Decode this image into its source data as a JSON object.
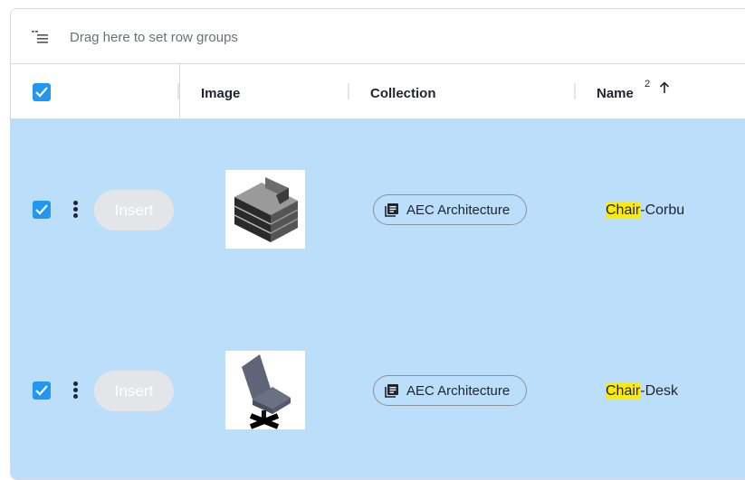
{
  "group_bar": {
    "placeholder": "Drag here to set row groups",
    "icon": "row-groups-icon"
  },
  "header": {
    "columns": [
      {
        "label": "Image"
      },
      {
        "label": "Collection"
      },
      {
        "label": "Name",
        "sort_index": "2",
        "sort_direction": "ascending"
      }
    ]
  },
  "rows": [
    {
      "selected": true,
      "action_label": "Insert",
      "image_icon": "sofa-thumbnail",
      "collection": "AEC Architecture",
      "name_highlight": "Chair",
      "name_rest": "-Corbu"
    },
    {
      "selected": true,
      "action_label": "Insert",
      "image_icon": "desk-chair-thumbnail",
      "collection": "AEC Architecture",
      "name_highlight": "Chair",
      "name_rest": "-Desk"
    }
  ],
  "colors": {
    "selected_row": "#bbdefb",
    "checkbox": "#2196f3",
    "highlight": "#ffeb00"
  }
}
